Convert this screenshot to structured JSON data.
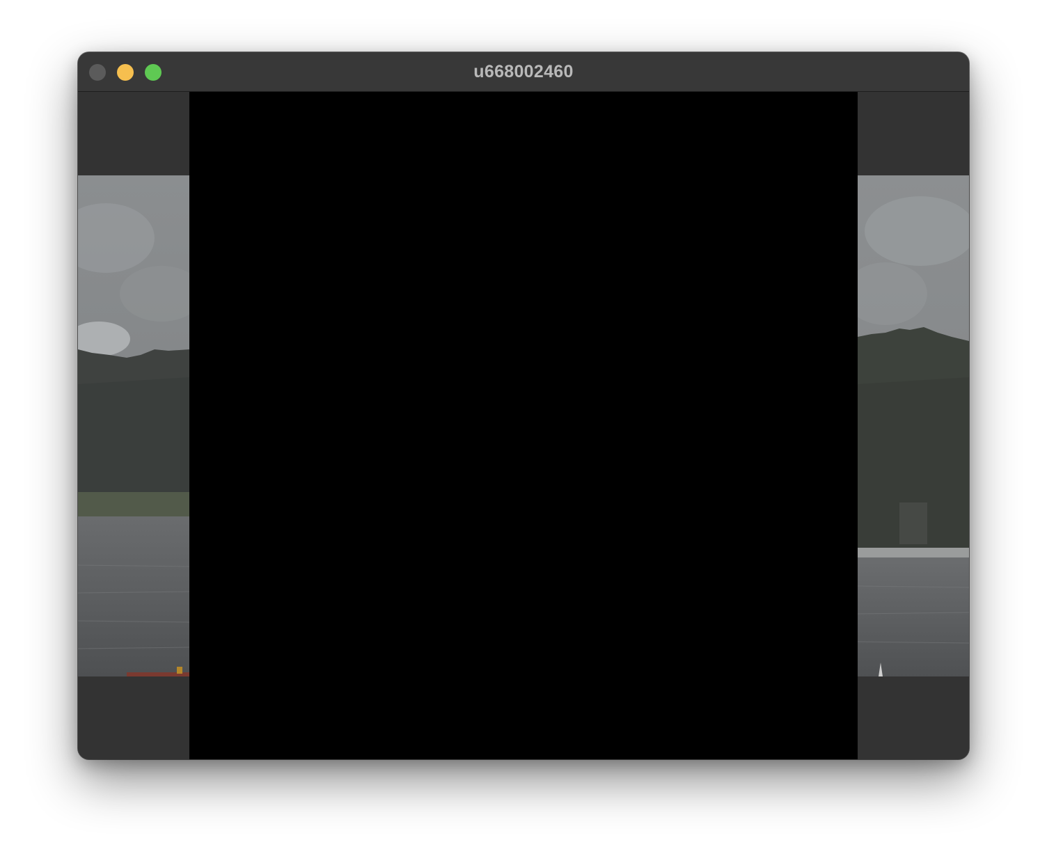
{
  "window": {
    "title": "u668002460"
  },
  "window_controls": {
    "close_icon": "close-icon",
    "minimize_icon": "minimize-icon",
    "maximize_icon": "maximize-icon",
    "colors": {
      "close": "#5b5b5b",
      "minimize": "#f6bf4f",
      "maximize": "#5fc953"
    }
  },
  "viewer": {
    "main_image_color": "#000000",
    "side_images": [
      "previous-photo-thumbnail",
      "next-photo-thumbnail"
    ]
  }
}
